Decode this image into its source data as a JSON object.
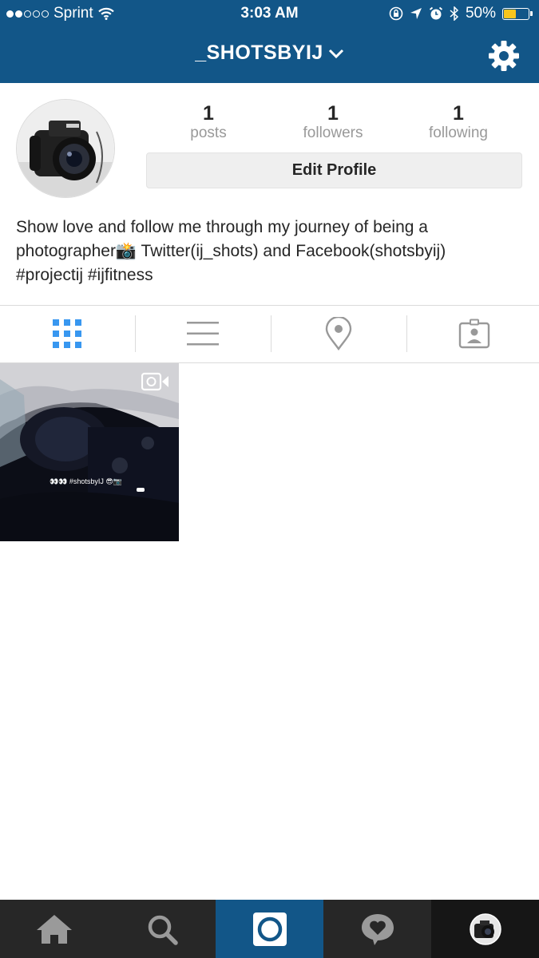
{
  "status_bar": {
    "carrier": "Sprint",
    "time": "3:03 AM",
    "battery": "50%",
    "battery_level": 0.5,
    "signal_bars_filled": 2,
    "signal_bars_total": 5
  },
  "header": {
    "username": "_SHOTSBYIJ",
    "background_color": "#125688"
  },
  "profile": {
    "stats": [
      {
        "value": "1",
        "label": "posts"
      },
      {
        "value": "1",
        "label": "followers"
      },
      {
        "value": "1",
        "label": "following"
      }
    ],
    "edit_button_label": "Edit Profile",
    "bio_line1": "Show love and follow me through my journey of being a",
    "bio_line2": "photographer📸 Twitter(ij_shots) and Facebook(shotsbyij)",
    "bio_line3": "#projectij #ijfitness"
  },
  "tabs": [
    {
      "icon": "grid-icon",
      "active": true
    },
    {
      "icon": "list-icon",
      "active": false
    },
    {
      "icon": "location-pin-icon",
      "active": false
    },
    {
      "icon": "tagged-photos-icon",
      "active": false
    }
  ],
  "posts": [
    {
      "type": "video",
      "caption": "👀👀 #shotsbyIJ 😎📷"
    }
  ],
  "bottom_nav": [
    {
      "icon": "home-icon"
    },
    {
      "icon": "search-icon"
    },
    {
      "icon": "camera-icon",
      "active": true
    },
    {
      "icon": "activity-heart-icon"
    },
    {
      "icon": "profile-avatar"
    }
  ],
  "colors": {
    "brand": "#125688",
    "active_tab": "#3897f0",
    "nav_background": "#272727",
    "battery": "#f8c51c"
  }
}
